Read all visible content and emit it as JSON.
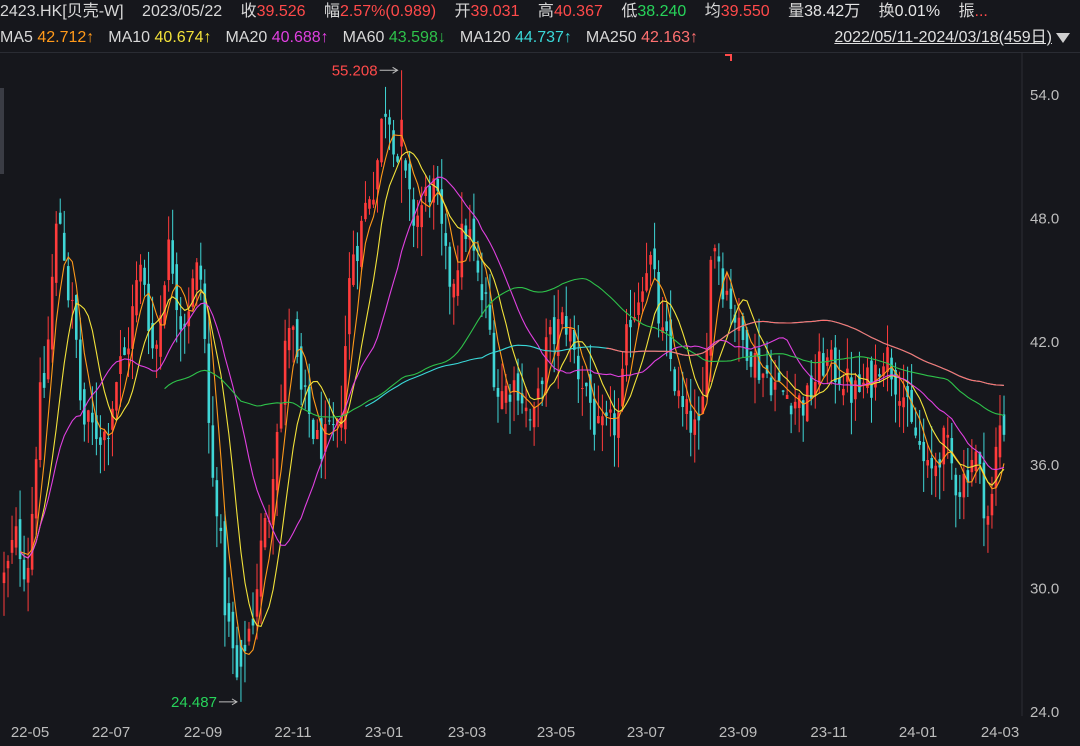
{
  "header": {
    "symbol": "2423.HK[贝壳-W]",
    "date": "2023/05/22",
    "close_label": "收",
    "close": "39.526",
    "change_label": "幅",
    "change": "2.57%(0.989)",
    "open_label": "开",
    "open": "39.031",
    "high_label": "高",
    "high": "40.367",
    "low_label": "低",
    "low": "38.240",
    "avg_label": "均",
    "avg": "39.550",
    "vol_label": "量",
    "vol": "38.42万",
    "turnover_label": "换",
    "turnover": "0.01%",
    "amp_label": "振",
    "amp": "..."
  },
  "ma_row": [
    {
      "name": "MA5",
      "value": "42.712↑",
      "color": "#ff9a1a"
    },
    {
      "name": "MA10",
      "value": "40.674↑",
      "color": "#f2e23a"
    },
    {
      "name": "MA20",
      "value": "40.688↑",
      "color": "#e040e0"
    },
    {
      "name": "MA60",
      "value": "43.598↓",
      "color": "#2ec24a"
    },
    {
      "name": "MA120",
      "value": "44.737↑",
      "color": "#3ad8d8"
    },
    {
      "name": "MA250",
      "value": "42.163↑",
      "color": "#ff7070"
    }
  ],
  "range_label": "2022/05/11-2024/03/18(459日)",
  "chart_data": {
    "type": "candlestick",
    "x_ticks": [
      "22-05",
      "22-07",
      "22-09",
      "22-11",
      "23-01",
      "23-03",
      "23-05",
      "23-07",
      "23-09",
      "23-11",
      "24-01",
      "24-03"
    ],
    "y_ticks": [
      "54.0",
      "48.0",
      "42.0",
      "36.0",
      "30.0",
      "24.0"
    ],
    "ylim": [
      23.8,
      56.0
    ],
    "annotations": [
      {
        "text": "55.208",
        "value": 55.208,
        "kind": "high",
        "color": "#ff4a4a"
      },
      {
        "text": "24.487",
        "value": 24.487,
        "kind": "low",
        "color": "#27d35a"
      }
    ],
    "key_points": [
      {
        "x": 0,
        "v": 30.5
      },
      {
        "x": 12,
        "v": 32.5
      },
      {
        "x": 22,
        "v": 31.0
      },
      {
        "x": 38,
        "v": 39.5
      },
      {
        "x": 55,
        "v": 48.0
      },
      {
        "x": 68,
        "v": 43.5
      },
      {
        "x": 80,
        "v": 38.0
      },
      {
        "x": 100,
        "v": 37.5
      },
      {
        "x": 118,
        "v": 41.0
      },
      {
        "x": 138,
        "v": 45.5
      },
      {
        "x": 150,
        "v": 41.5
      },
      {
        "x": 165,
        "v": 46.5
      },
      {
        "x": 178,
        "v": 43.0
      },
      {
        "x": 195,
        "v": 45.5
      },
      {
        "x": 210,
        "v": 35.0
      },
      {
        "x": 225,
        "v": 28.0
      },
      {
        "x": 233,
        "v": 25.5
      },
      {
        "x": 245,
        "v": 28.0
      },
      {
        "x": 262,
        "v": 33.0
      },
      {
        "x": 275,
        "v": 38.5
      },
      {
        "x": 285,
        "v": 43.0
      },
      {
        "x": 300,
        "v": 39.0
      },
      {
        "x": 315,
        "v": 37.0
      },
      {
        "x": 333,
        "v": 37.5
      },
      {
        "x": 350,
        "v": 46.5
      },
      {
        "x": 368,
        "v": 49.5
      },
      {
        "x": 382,
        "v": 53.5
      },
      {
        "x": 397,
        "v": 50.5
      },
      {
        "x": 410,
        "v": 48.0
      },
      {
        "x": 428,
        "v": 49.5
      },
      {
        "x": 447,
        "v": 45.0
      },
      {
        "x": 462,
        "v": 47.5
      },
      {
        "x": 480,
        "v": 44.0
      },
      {
        "x": 495,
        "v": 39.5
      },
      {
        "x": 512,
        "v": 40.0
      },
      {
        "x": 528,
        "v": 38.0
      },
      {
        "x": 545,
        "v": 42.0
      },
      {
        "x": 560,
        "v": 43.0
      },
      {
        "x": 580,
        "v": 40.0
      },
      {
        "x": 595,
        "v": 37.5
      },
      {
        "x": 612,
        "v": 38.0
      },
      {
        "x": 628,
        "v": 43.5
      },
      {
        "x": 645,
        "v": 46.0
      },
      {
        "x": 660,
        "v": 42.0
      },
      {
        "x": 680,
        "v": 38.5
      },
      {
        "x": 695,
        "v": 37.5
      },
      {
        "x": 710,
        "v": 47.0
      },
      {
        "x": 722,
        "v": 44.5
      },
      {
        "x": 740,
        "v": 42.0
      },
      {
        "x": 760,
        "v": 40.5
      },
      {
        "x": 780,
        "v": 39.5
      },
      {
        "x": 800,
        "v": 39.0
      },
      {
        "x": 820,
        "v": 41.0
      },
      {
        "x": 835,
        "v": 40.5
      },
      {
        "x": 850,
        "v": 39.5
      },
      {
        "x": 865,
        "v": 40.0
      },
      {
        "x": 880,
        "v": 41.5
      },
      {
        "x": 895,
        "v": 40.0
      },
      {
        "x": 910,
        "v": 37.5
      },
      {
        "x": 925,
        "v": 35.5
      },
      {
        "x": 940,
        "v": 37.0
      },
      {
        "x": 955,
        "v": 35.0
      },
      {
        "x": 970,
        "v": 36.5
      },
      {
        "x": 985,
        "v": 33.5
      },
      {
        "x": 996,
        "v": 38.0
      }
    ],
    "high_marker": {
      "x": 398,
      "v": 55.208
    },
    "low_marker": {
      "x": 235,
      "v": 24.487
    },
    "ma": [
      {
        "name": "MA5",
        "color": "#ff9a1a",
        "window": 5
      },
      {
        "name": "MA10",
        "color": "#f2e23a",
        "window": 10
      },
      {
        "name": "MA20",
        "color": "#e040e0",
        "window": 20
      },
      {
        "name": "MA60",
        "color": "#2ec24a",
        "window": 60
      },
      {
        "name": "MA120",
        "color": "#3ad8d8",
        "window": 120
      },
      {
        "name": "MA250",
        "color": "#ff7070",
        "window": 250
      }
    ],
    "up_color": "#ff3b3b",
    "down_color": "#3fd6d6"
  }
}
